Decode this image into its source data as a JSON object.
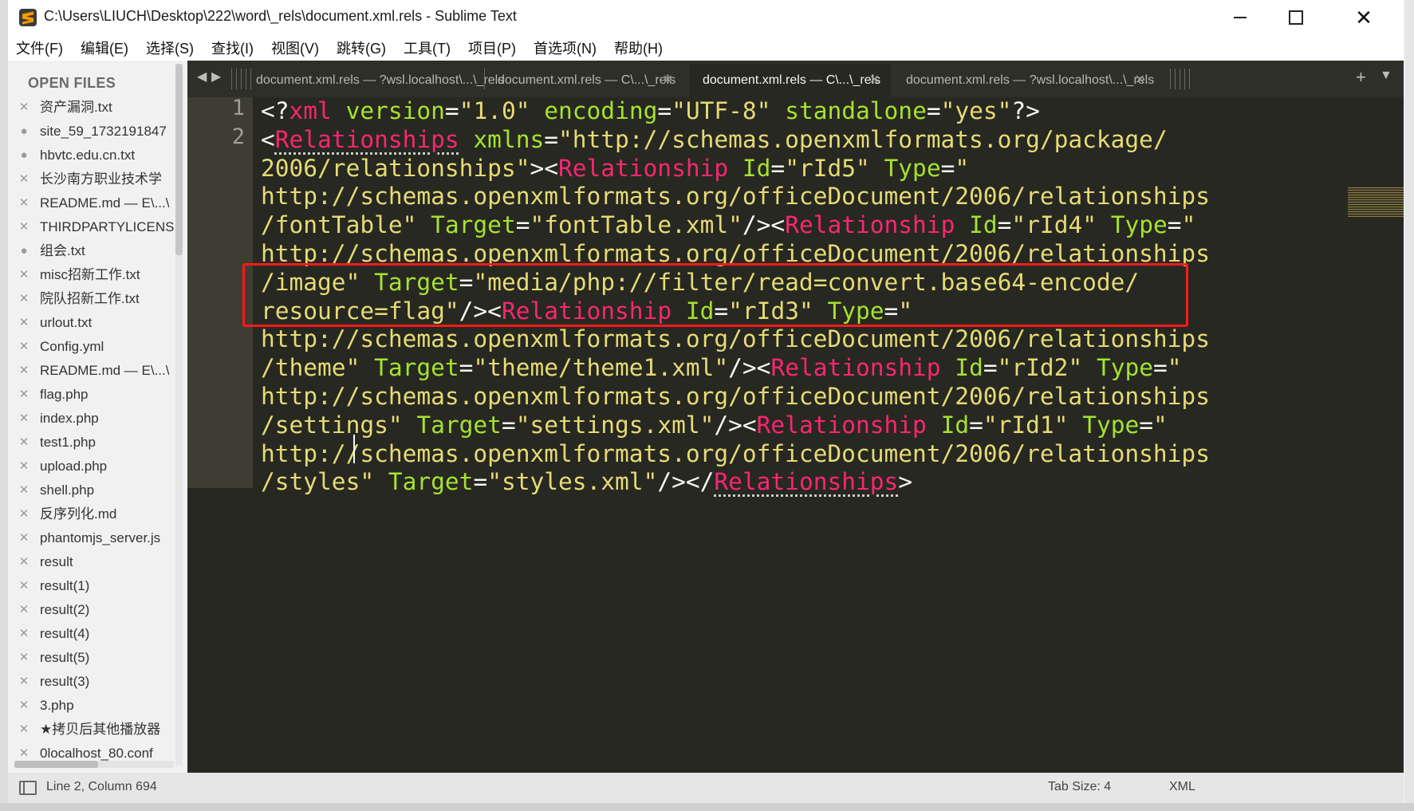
{
  "window": {
    "title": "C:\\Users\\LIUCH\\Desktop\\222\\word\\_rels\\document.xml.rels - Sublime Text",
    "app_icon": "sublime-text-icon"
  },
  "menu": [
    "文件(F)",
    "编辑(E)",
    "选择(S)",
    "查找(I)",
    "视图(V)",
    "跳转(G)",
    "工具(T)",
    "项目(P)",
    "首选项(N)",
    "帮助(H)"
  ],
  "sidebar": {
    "heading": "OPEN FILES",
    "files": [
      {
        "name": "资产漏洞.txt",
        "mark": "✕"
      },
      {
        "name": "site_59_1732191847",
        "mark": "●"
      },
      {
        "name": "hbvtc.edu.cn.txt",
        "mark": "●"
      },
      {
        "name": "长沙南方职业技术学",
        "mark": "✕"
      },
      {
        "name": "README.md — E\\...\\",
        "mark": "✕"
      },
      {
        "name": "THIRDPARTYLICENS",
        "mark": "✕"
      },
      {
        "name": "组会.txt",
        "mark": "●"
      },
      {
        "name": "misc招新工作.txt",
        "mark": "✕"
      },
      {
        "name": "院队招新工作.txt",
        "mark": "✕"
      },
      {
        "name": "urlout.txt",
        "mark": "✕"
      },
      {
        "name": "Config.yml",
        "mark": "✕"
      },
      {
        "name": "README.md — E\\...\\",
        "mark": "✕"
      },
      {
        "name": "flag.php",
        "mark": "✕"
      },
      {
        "name": "index.php",
        "mark": "✕"
      },
      {
        "name": "test1.php",
        "mark": "✕"
      },
      {
        "name": "upload.php",
        "mark": "✕"
      },
      {
        "name": "shell.php",
        "mark": "✕"
      },
      {
        "name": "反序列化.md",
        "mark": "✕"
      },
      {
        "name": "phantomjs_server.js",
        "mark": "✕"
      },
      {
        "name": "result",
        "mark": "✕"
      },
      {
        "name": "result(1)",
        "mark": "✕"
      },
      {
        "name": "result(2)",
        "mark": "✕"
      },
      {
        "name": "result(4)",
        "mark": "✕"
      },
      {
        "name": "result(5)",
        "mark": "✕"
      },
      {
        "name": "result(3)",
        "mark": "✕"
      },
      {
        "name": "3.php",
        "mark": "✕"
      },
      {
        "name": "★拷贝后其他播放器",
        "mark": "✕"
      },
      {
        "name": "0localhost_80.conf",
        "mark": "✕"
      }
    ]
  },
  "tabs": [
    {
      "label": "document.xml.rels — ?wsl.localhost\\...\\_rels",
      "active": false,
      "close": ""
    },
    {
      "label": "document.xml.rels — C\\...\\_rels",
      "active": false,
      "close": "✕"
    },
    {
      "label": "document.xml.rels — C\\...\\_rels",
      "active": true,
      "close": "✕"
    },
    {
      "label": "document.xml.rels — ?wsl.localhost\\...\\_rels",
      "active": false,
      "close": "✕"
    }
  ],
  "tab_controls": {
    "prev": "◀",
    "next": "▶",
    "add": "+",
    "more": "▼"
  },
  "editor": {
    "line_numbers": [
      "1",
      "2"
    ],
    "visual_lines": [
      [
        [
          "pu",
          "<?"
        ],
        [
          "tg",
          "xml"
        ],
        [
          "pu",
          " "
        ],
        [
          "at",
          "version"
        ],
        [
          "pu",
          "="
        ],
        [
          "st",
          "\"1.0\""
        ],
        [
          "pu",
          " "
        ],
        [
          "at",
          "encoding"
        ],
        [
          "pu",
          "="
        ],
        [
          "st",
          "\"UTF-8\""
        ],
        [
          "pu",
          " "
        ],
        [
          "at",
          "standalone"
        ],
        [
          "pu",
          "="
        ],
        [
          "st",
          "\"yes\""
        ],
        [
          "pu",
          "?>"
        ]
      ],
      [
        [
          "pu",
          "<"
        ],
        [
          "tg ul",
          "Relationships"
        ],
        [
          "pu",
          " "
        ],
        [
          "at",
          "xmlns"
        ],
        [
          "pu",
          "="
        ],
        [
          "st",
          "\"http://schemas.openxmlformats.org/package/"
        ]
      ],
      [
        [
          "st",
          "2006/relationships\""
        ],
        [
          "pu",
          "><"
        ],
        [
          "tg",
          "Relationship"
        ],
        [
          "pu",
          " "
        ],
        [
          "at",
          "Id"
        ],
        [
          "pu",
          "="
        ],
        [
          "st",
          "\"rId5\""
        ],
        [
          "pu",
          " "
        ],
        [
          "at",
          "Type"
        ],
        [
          "pu",
          "="
        ],
        [
          "st",
          "\""
        ]
      ],
      [
        [
          "st",
          "http://schemas.openxmlformats.org/officeDocument/2006/relationships"
        ]
      ],
      [
        [
          "st",
          "/fontTable\""
        ],
        [
          "pu",
          " "
        ],
        [
          "at",
          "Target"
        ],
        [
          "pu",
          "="
        ],
        [
          "st",
          "\"fontTable.xml\""
        ],
        [
          "pu",
          "/><"
        ],
        [
          "tg",
          "Relationship"
        ],
        [
          "pu",
          " "
        ],
        [
          "at",
          "Id"
        ],
        [
          "pu",
          "="
        ],
        [
          "st",
          "\"rId4\""
        ],
        [
          "pu",
          " "
        ],
        [
          "at",
          "Type"
        ],
        [
          "pu",
          "="
        ],
        [
          "st",
          "\""
        ]
      ],
      [
        [
          "st",
          "http://schemas.openxmlformats.org/officeDocument/2006/relationships"
        ]
      ],
      [
        [
          "st",
          "/image\""
        ],
        [
          "pu",
          " "
        ],
        [
          "at",
          "Target"
        ],
        [
          "pu",
          "="
        ],
        [
          "st",
          "\"media/php://filter/read=convert.base64-encode/"
        ]
      ],
      [
        [
          "st",
          "resource=flag\""
        ],
        [
          "pu",
          "/><"
        ],
        [
          "tg",
          "Relationship"
        ],
        [
          "pu",
          " "
        ],
        [
          "at",
          "Id"
        ],
        [
          "pu",
          "="
        ],
        [
          "st",
          "\"rId3\""
        ],
        [
          "pu",
          " "
        ],
        [
          "at",
          "Type"
        ],
        [
          "pu",
          "="
        ],
        [
          "st",
          "\""
        ]
      ],
      [
        [
          "st",
          "http://schemas.openxmlformats.org/officeDocument/2006/relationships"
        ]
      ],
      [
        [
          "st",
          "/theme\""
        ],
        [
          "pu",
          " "
        ],
        [
          "at",
          "Target"
        ],
        [
          "pu",
          "="
        ],
        [
          "st",
          "\"theme/theme1.xml\""
        ],
        [
          "pu",
          "/><"
        ],
        [
          "tg",
          "Relationship"
        ],
        [
          "pu",
          " "
        ],
        [
          "at",
          "Id"
        ],
        [
          "pu",
          "="
        ],
        [
          "st",
          "\"rId2\""
        ],
        [
          "pu",
          " "
        ],
        [
          "at",
          "Type"
        ],
        [
          "pu",
          "="
        ],
        [
          "st",
          "\""
        ]
      ],
      [
        [
          "st",
          "http://schemas.openxmlformats.org/officeDocument/2006/relationships"
        ]
      ],
      [
        [
          "st",
          "/settings\""
        ],
        [
          "pu",
          " "
        ],
        [
          "at",
          "Target"
        ],
        [
          "pu",
          "="
        ],
        [
          "st",
          "\"settings.xml\""
        ],
        [
          "pu",
          "/><"
        ],
        [
          "tg",
          "Relationship"
        ],
        [
          "pu",
          " "
        ],
        [
          "at",
          "Id"
        ],
        [
          "pu",
          "="
        ],
        [
          "st",
          "\"rId1\""
        ],
        [
          "pu",
          " "
        ],
        [
          "at",
          "Type"
        ],
        [
          "pu",
          "="
        ],
        [
          "st",
          "\""
        ]
      ],
      [
        [
          "st",
          "http://schemas.openxmlformats.org/officeDocument/2006/relationships"
        ]
      ],
      [
        [
          "st",
          "/styles\""
        ],
        [
          "pu",
          " "
        ],
        [
          "at",
          "Target"
        ],
        [
          "pu",
          "="
        ],
        [
          "st",
          "\"styles.xml\""
        ],
        [
          "pu",
          "/></"
        ],
        [
          "tg ul",
          "Relationships"
        ],
        [
          "pu",
          ">"
        ]
      ]
    ]
  },
  "status": {
    "position": "Line 2, Column 694",
    "tab_size": "Tab Size: 4",
    "syntax": "XML"
  }
}
